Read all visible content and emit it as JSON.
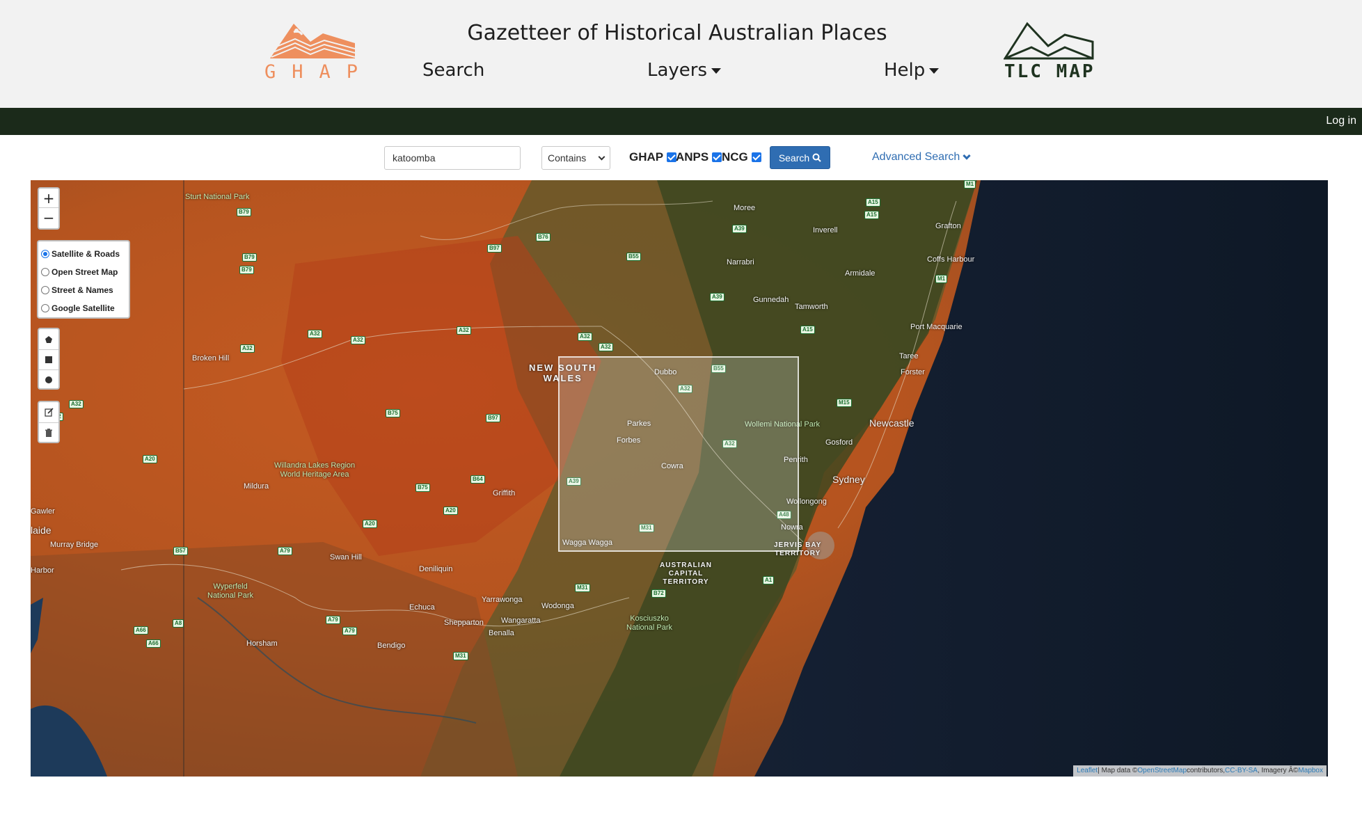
{
  "header": {
    "title": "Gazetteer of Historical Australian Places",
    "ghap_letters": [
      "G",
      "H",
      "A",
      "P"
    ],
    "ghap_color": "#ee8f5e",
    "tlc_text": "TLC MAP",
    "nav": {
      "search": "Search",
      "layers": "Layers",
      "help": "Help"
    }
  },
  "topbar": {
    "login": "Log in",
    "color": "#1b2a1a"
  },
  "search": {
    "query": "katoomba",
    "match_mode": "Contains",
    "sources": [
      {
        "label": "GHAP",
        "checked": true
      },
      {
        "label": "ANPS",
        "checked": true
      },
      {
        "label": "NCG",
        "checked": true
      }
    ],
    "button_label": "Search",
    "advanced_label": "Advanced Search",
    "accent_color": "#2f6db2"
  },
  "map": {
    "zoom_in": "+",
    "zoom_out": "−",
    "layers": [
      {
        "label": "Satellite & Roads",
        "selected": true
      },
      {
        "label": "Open Street Map",
        "selected": false
      },
      {
        "label": "Street & Names",
        "selected": false
      },
      {
        "label": "Google Satellite",
        "selected": false
      }
    ],
    "draw_tools": [
      "polygon-icon",
      "rectangle-icon",
      "circle-icon"
    ],
    "edit_tools": [
      "edit-icon",
      "trash-icon"
    ],
    "places": {
      "sturt": "Sturt National Park",
      "moree": "Moree",
      "inverell": "Inverell",
      "grafton": "Grafton",
      "coffs": "Coffs Harbour",
      "narrabri": "Narrabri",
      "armidale": "Armidale",
      "gunnedah": "Gunnedah",
      "tamworth": "Tamworth",
      "portmac": "Port Macquarie",
      "taree": "Taree",
      "forster": "Forster",
      "brokenhill": "Broken Hill",
      "nsw": "NEW SOUTH\nWALES",
      "dubbo": "Dubbo",
      "newcastle": "Newcastle",
      "wollemi": "Wollemi National Park",
      "parkes": "Parkes",
      "forbes": "Forbes",
      "gosford": "Gosford",
      "penrith": "Penrith",
      "sydney": "Sydney",
      "willandra": "Willandra Lakes Region\nWorld Heritage Area",
      "cowra": "Cowra",
      "mildura": "Mildura",
      "griffith": "Griffith",
      "wollongong": "Wollongong",
      "gawler": "Gawler",
      "adelaide": "laide",
      "murraybridge": "Murray Bridge",
      "nowra": "Nowra",
      "waggawagga": "Wagga Wagga",
      "jervis": "JERVIS BAY\nTERRITORY",
      "swanhill": "Swan Hill",
      "deniliquin": "Deniliquin",
      "act": "AUSTRALIAN\nCAPITAL\nTERRITORY",
      "harbor": "Harbor",
      "wyperfeld": "Wyperfeld\nNational Park",
      "yarrawonga": "Yarrawonga",
      "echuca": "Echuca",
      "wodonga": "Wodonga",
      "kosciuszko": "Kosciuszko\nNational Park",
      "shepparton": "Shepparton",
      "wangaratta": "Wangaratta",
      "benalla": "Benalla",
      "horsham": "Horsham",
      "bendigo": "Bendigo"
    },
    "shields": [
      "M1",
      "A15",
      "A15",
      "B79",
      "A39",
      "B76",
      "B97",
      "B55",
      "B79",
      "B79",
      "M1",
      "A39",
      "A15",
      "A32",
      "A32",
      "A32",
      "A32",
      "A32",
      "A32",
      "B55",
      "A32",
      "A32",
      "A32",
      "M15",
      "B75",
      "B97",
      "A32",
      "B64",
      "A39",
      "B75",
      "A20",
      "A20",
      "A20",
      "M31",
      "A48",
      "B57",
      "A79",
      "M31",
      "B72",
      "A1",
      "A8",
      "A79",
      "A79",
      "A66",
      "A66",
      "M31"
    ],
    "attribution": {
      "leaflet": "Leaflet",
      "text1": " | Map data © ",
      "osm": "OpenStreetMap",
      "text2": " contributors, ",
      "license": "CC-BY-SA",
      "text3": ", Imagery Â© ",
      "mapbox": "Mapbox"
    }
  }
}
